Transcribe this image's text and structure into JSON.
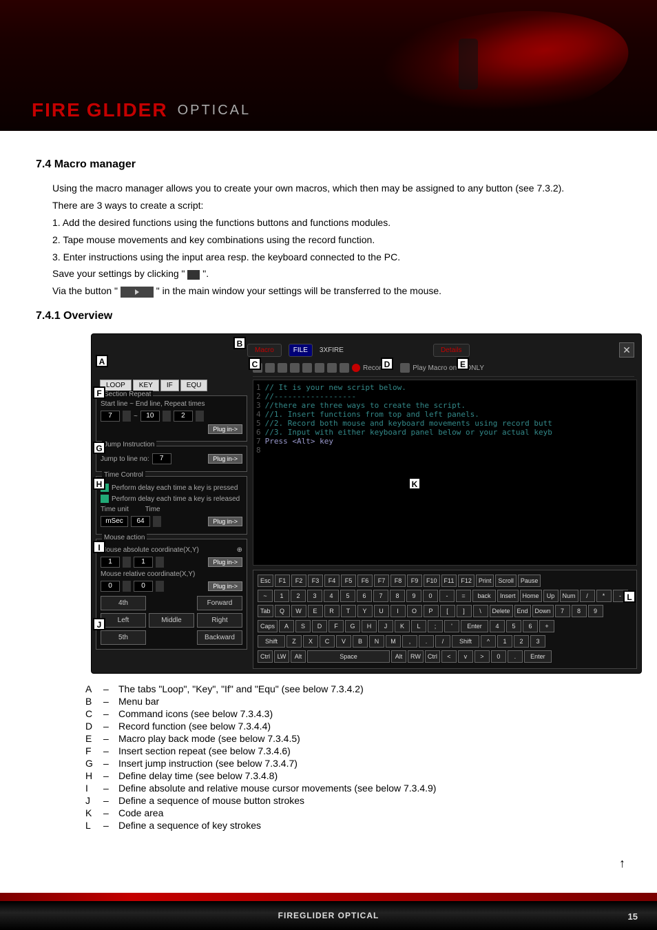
{
  "header": {
    "logo_fire": "FIRE",
    "logo_glider": "GLIDER",
    "logo_optical": "OPTICAL"
  },
  "sec74": {
    "title": "7.4 Macro manager",
    "p1": "Using the macro manager allows you to create your own macros, which then may be assigned to any button (see 7.3.2).",
    "p2": "There are 3 ways to create a script:",
    "l1": "1.  Add the desired functions using the functions buttons and functions modules.",
    "l2": "2.  Tape mouse movements and key combinations using the record function.",
    "l3": "3.  Enter instructions using the input area resp. the keyboard connected to the PC.",
    "p3a": "Save your settings by clicking \"",
    "p3b": "\".",
    "p4a": "Via the button \"",
    "p4b": "\" in the main window your settings will be transferred to the mouse."
  },
  "sec741": {
    "title": "7.4.1 Overview"
  },
  "menubar": {
    "macro": "Macro",
    "file": "FILE",
    "filename": "3XFIRE",
    "details": "Details"
  },
  "toolbar": {
    "record": "Record",
    "playmode": "Play Macro once ONLY"
  },
  "tabs": {
    "loop": "LOOP",
    "key": "KEY",
    "if": "IF",
    "equ": "EQU"
  },
  "sectionRepeat": {
    "legend": "Section Repeat",
    "labels": "Start line  ~  End line,  Repeat times",
    "start": "7",
    "end": "10",
    "times": "2",
    "btn": "Plug in->"
  },
  "jump": {
    "legend": "Jump Instruction",
    "label": "Jump to line no:",
    "val": "7",
    "btn": "Plug in->"
  },
  "timectrl": {
    "legend": "Time Control",
    "cb1": "Perform delay each time a key is pressed",
    "cb2": "Perform delay each time a key is released",
    "unitlabel": "Time unit",
    "timelabel": "Time",
    "unit": "mSec",
    "time": "64",
    "btn": "Plug in->"
  },
  "mouseact": {
    "legend": "Mouse action",
    "abslabel": "Mouse absolute coordinate(X,Y)",
    "absx": "1",
    "absy": "1",
    "btn1": "Plug in->",
    "rellabel": "Mouse relative coordinate(X,Y)",
    "relx": "0",
    "rely": "0",
    "btn2": "Plug in->",
    "m1": "4th",
    "m2": "Forward",
    "m3": "Left",
    "m4": "Middle",
    "m5": "Right",
    "m6": "5th",
    "m7": "Backward"
  },
  "code": {
    "l1": "//   It is your new script below.",
    "l2": "//------------------",
    "l3": "//there are three ways to create the script.",
    "l4": "//1. Insert functions from top and left panels.",
    "l5": "//2. Record both mouse and keyboard movements using record butt",
    "l6": "//3. Input with either keyboard panel below or your actual keyb",
    "l7": "Press <Alt> key"
  },
  "kb": {
    "row1": [
      "Esc",
      "F1",
      "F2",
      "F3",
      "F4",
      "F5",
      "F6",
      "F7",
      "F8",
      "F9",
      "F10",
      "F11",
      "F12",
      "Print",
      "Scroll",
      "Pause"
    ],
    "row2": [
      "~",
      "1",
      "2",
      "3",
      "4",
      "5",
      "6",
      "7",
      "8",
      "9",
      "0",
      "-",
      "=",
      "back",
      "Insert",
      "Home",
      "Up",
      "Num",
      "/",
      "*",
      "-"
    ],
    "row3": [
      "Tab",
      "Q",
      "W",
      "E",
      "R",
      "T",
      "Y",
      "U",
      "I",
      "O",
      "P",
      "[",
      "]",
      "\\",
      "Delete",
      "End",
      "Down",
      "7",
      "8",
      "9"
    ],
    "row4": [
      "Caps",
      "A",
      "S",
      "D",
      "F",
      "G",
      "H",
      "J",
      "K",
      "L",
      ";",
      "'",
      "Enter",
      "4",
      "5",
      "6",
      "+"
    ],
    "row5": [
      "Shift",
      "Z",
      "X",
      "C",
      "V",
      "B",
      "N",
      "M",
      ",",
      ".",
      "/",
      "Shift",
      "^",
      "1",
      "2",
      "3"
    ],
    "row6": [
      "Ctrl",
      "LW",
      "Alt",
      "Space",
      "Alt",
      "RW",
      "Ctrl",
      "<",
      "v",
      ">",
      "0",
      ".",
      "Enter"
    ]
  },
  "markers": {
    "A": "A",
    "B": "B",
    "C": "C",
    "D": "D",
    "E": "E",
    "F": "F",
    "G": "G",
    "H": "H",
    "I": "I",
    "J": "J",
    "K": "K",
    "L": "L"
  },
  "legend": {
    "A": "The tabs \"Loop\", \"Key\", \"If\" and \"Equ\" (see below 7.3.4.2)",
    "B": "Menu bar",
    "C": "Command icons (see below 7.3.4.3)",
    "D": "Record function (see below 7.3.4.4)",
    "E": "Macro play back mode (see below 7.3.4.5)",
    "F": "Insert section repeat (see below 7.3.4.6)",
    "G": "Insert jump instruction (see below 7.3.4.7)",
    "H": "Define delay time (see below 7.3.4.8)",
    "I": "Define absolute and relative mouse cursor movements (see below 7.3.4.9)",
    "J": "Define a sequence of mouse button strokes",
    "K": "Code area",
    "L": "Define a sequence of key strokes"
  },
  "footer": {
    "title": "FIREGLIDER OPTICAL",
    "page": "15"
  }
}
